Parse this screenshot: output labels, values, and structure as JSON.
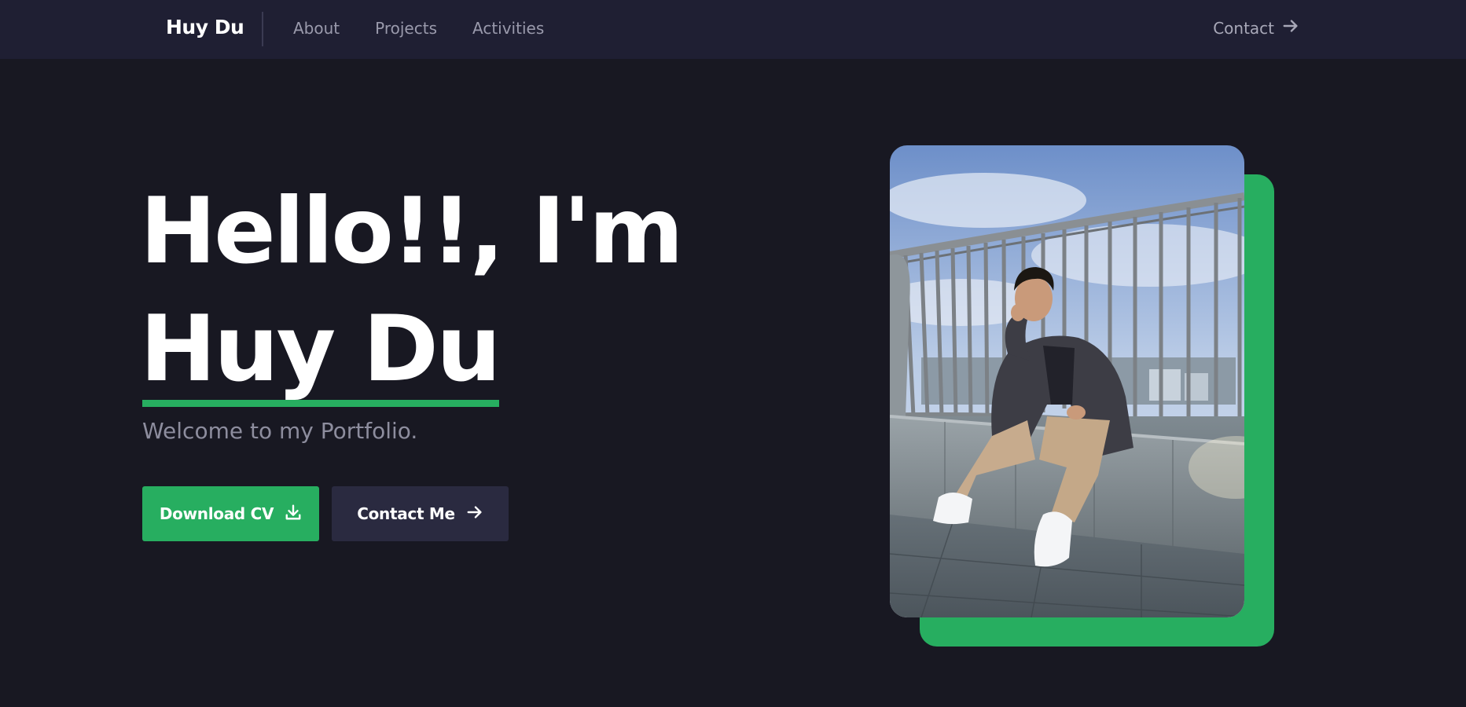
{
  "navbar": {
    "brand": "Huy Du",
    "links": [
      {
        "label": "About"
      },
      {
        "label": "Projects"
      },
      {
        "label": "Activities"
      }
    ],
    "contact_label": "Contact",
    "contact_icon": "arrow-right-icon"
  },
  "hero": {
    "greeting": "Hello!!, I'm",
    "name": "Huy Du",
    "subtitle": "Welcome to my Portfolio.",
    "buttons": {
      "download_label": "Download CV",
      "download_icon": "download-icon",
      "contact_label": "Contact Me",
      "contact_icon": "arrow-right-icon"
    }
  },
  "photo": {
    "subject": "portrait photo of a young man sitting on a concrete ledge by a metal railing"
  },
  "colors": {
    "background": "#181822",
    "navbar": "#1f1f33",
    "accent": "#27ae60",
    "secondary_button": "#2a2a40",
    "text_primary": "#ffffff",
    "text_muted": "#8d8d9e"
  }
}
